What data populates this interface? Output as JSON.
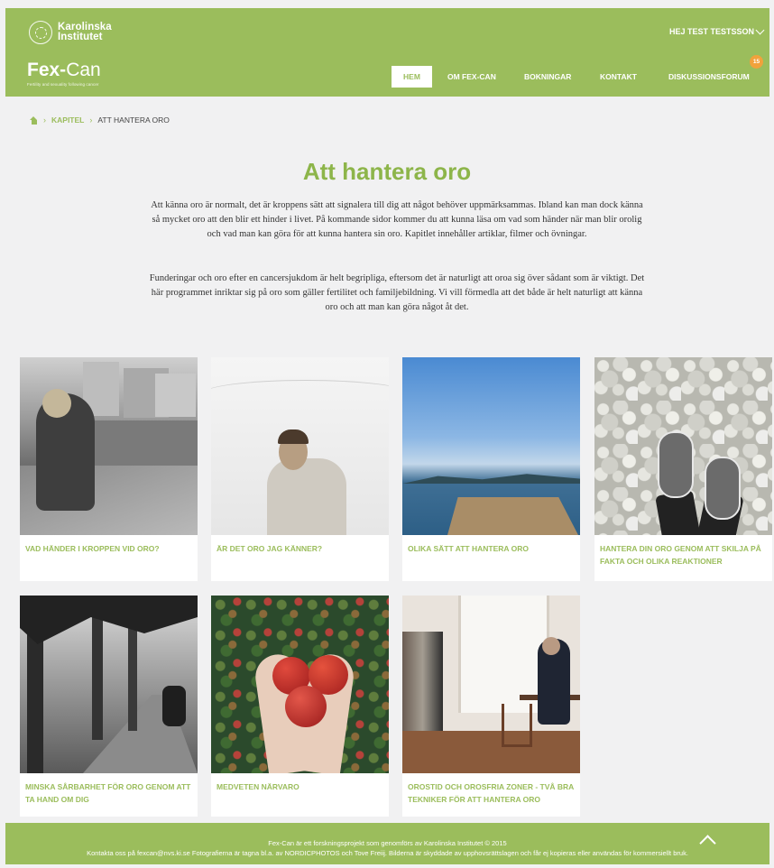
{
  "header": {
    "ki_logo_text": "Karolinska Institutet",
    "brand_bold": "Fex-",
    "brand_light": "Can",
    "brand_sub": "Fertility and sexuality following cancer",
    "user_menu": "HEJ TEST TESTSSON",
    "nav": [
      "HEM",
      "OM FEX-CAN",
      "BOKNINGAR",
      "KONTAKT",
      "DISKUSSIONSFORUM"
    ],
    "badge": "15",
    "color_green": "#9bbd5c",
    "icon_dropdown": "chevron-down-icon"
  },
  "breadcrumb": {
    "home_icon": "home-icon",
    "link": "KAPITEL",
    "current": "ATT HANTERA ORO"
  },
  "intro": {
    "title": "Att hantera oro",
    "p1": "Att känna oro är normalt, det är kroppens sätt att signalera till dig att något behöver uppmärksammas. Ibland kan man dock känna så mycket oro att den blir ett hinder i livet. På kommande sidor kommer du att kunna läsa om vad som händer när man blir orolig och vad man kan göra för att kunna hantera sin oro. Kapitlet innehåller artiklar, filmer och övningar.",
    "p2": "Funderingar och oro efter en cancersjukdom är helt begripliga, eftersom det är naturligt att oroa sig över sådant som är viktigt. Det här programmet inriktar sig på oro som gäller fertilitet och familjebildning. Vi vill förmedla att det både är helt naturligt att känna oro och att man kan göra något åt det."
  },
  "cards": [
    "VAD HÄNDER I KROPPEN VID ORO?",
    "ÄR DET ORO JAG KÄNNER?",
    "OLIKA SÄTT ATT HANTERA ORO",
    "HANTERA DIN ORO GENOM ATT SKILJA PÅ FAKTA OCH OLIKA REAKTIONER",
    "MINSKA SÅRBARHET FÖR ORO GENOM ATT TA HAND OM DIG",
    "MEDVETEN NÄRVARO",
    "OROSTID OCH OROSFRIA ZONER - TVÅ BRA TEKNIKER FÖR ATT HANTERA ORO"
  ],
  "footer": {
    "line1": "Fex-Can är ett forskningsprojekt som genomförs av Karolinska Institutet © 2015",
    "line2": "Kontakta oss på fexcan@nvs.ki.se Fotografierna är tagna bl.a. av NORDICPHOTOS och Tove Freiij. Bilderna är skyddade av upphovsrättslagen och får ej kopieras eller användas för kommersiellt bruk.",
    "scroll_top_icon": "chevron-up-icon"
  }
}
